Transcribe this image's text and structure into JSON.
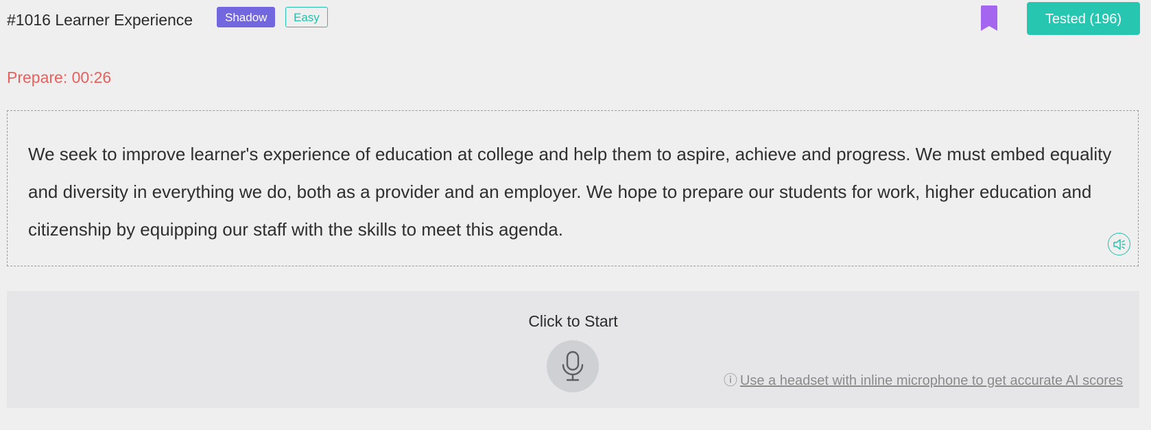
{
  "header": {
    "title": "#1016 Learner Experience",
    "tags": [
      {
        "label": "Shadow",
        "color": "#7367e0"
      },
      {
        "label": "Easy",
        "color": "#26bfad"
      }
    ],
    "bookmark_icon": "bookmark-icon",
    "bookmark_color": "#a566ef",
    "tested_button_label": "Tested (196)",
    "tested_button_color": "#26c6b1"
  },
  "timer": {
    "label": "Prepare: 00:26",
    "color": "#e8605c"
  },
  "passage": {
    "text": "We seek to improve learner's experience of education at college and help them to aspire, achieve and progress. We must embed equality and diversity in everything we do, both as a provider and an employer. We hope to prepare our students for work, higher education and citizenship by equipping our staff with the skills to meet this agenda.",
    "speaker_icon": "speaker-icon"
  },
  "recorder": {
    "prompt": "Click to Start",
    "mic_icon": "microphone-icon",
    "tip_icon_glyph": "ⓘ",
    "tip_text": "Use a headset with inline microphone to get accurate AI scores"
  }
}
